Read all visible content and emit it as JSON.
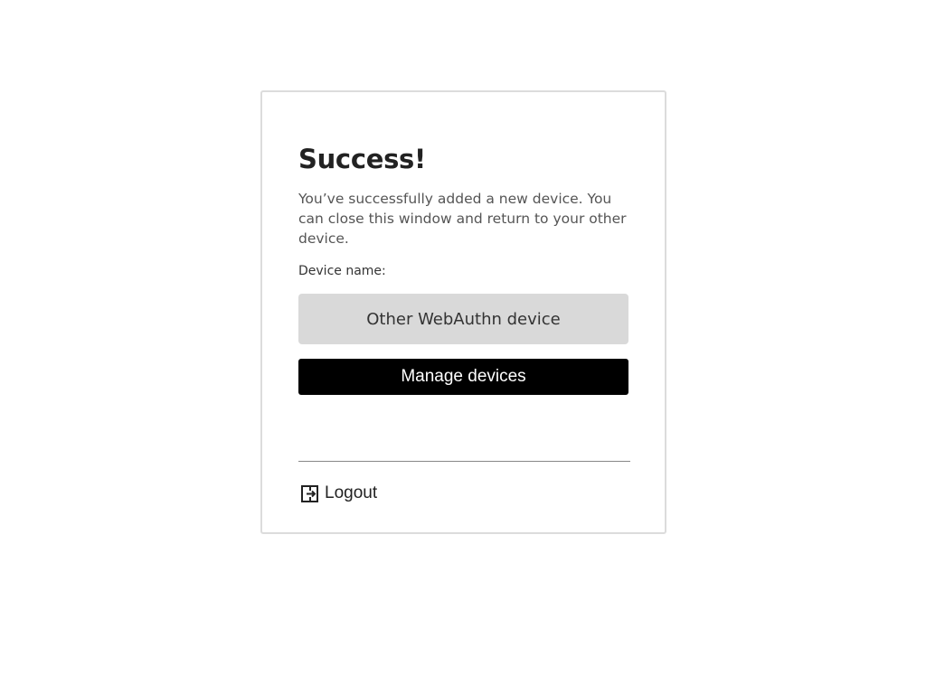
{
  "card": {
    "title": "Success!",
    "message": "You’ve successfully added a new device. You can close this window and return to your other device.",
    "device_name_label": "Device name:",
    "device_name_value": "Other WebAuthn device",
    "manage_button_label": "Manage devices",
    "logout": {
      "label": "Logout",
      "icon": "logout-icon"
    }
  },
  "colors": {
    "button_background": "#000000",
    "button_text": "#ffffff",
    "input_background": "#d9d9d9",
    "card_border": "#dcdcdc"
  }
}
